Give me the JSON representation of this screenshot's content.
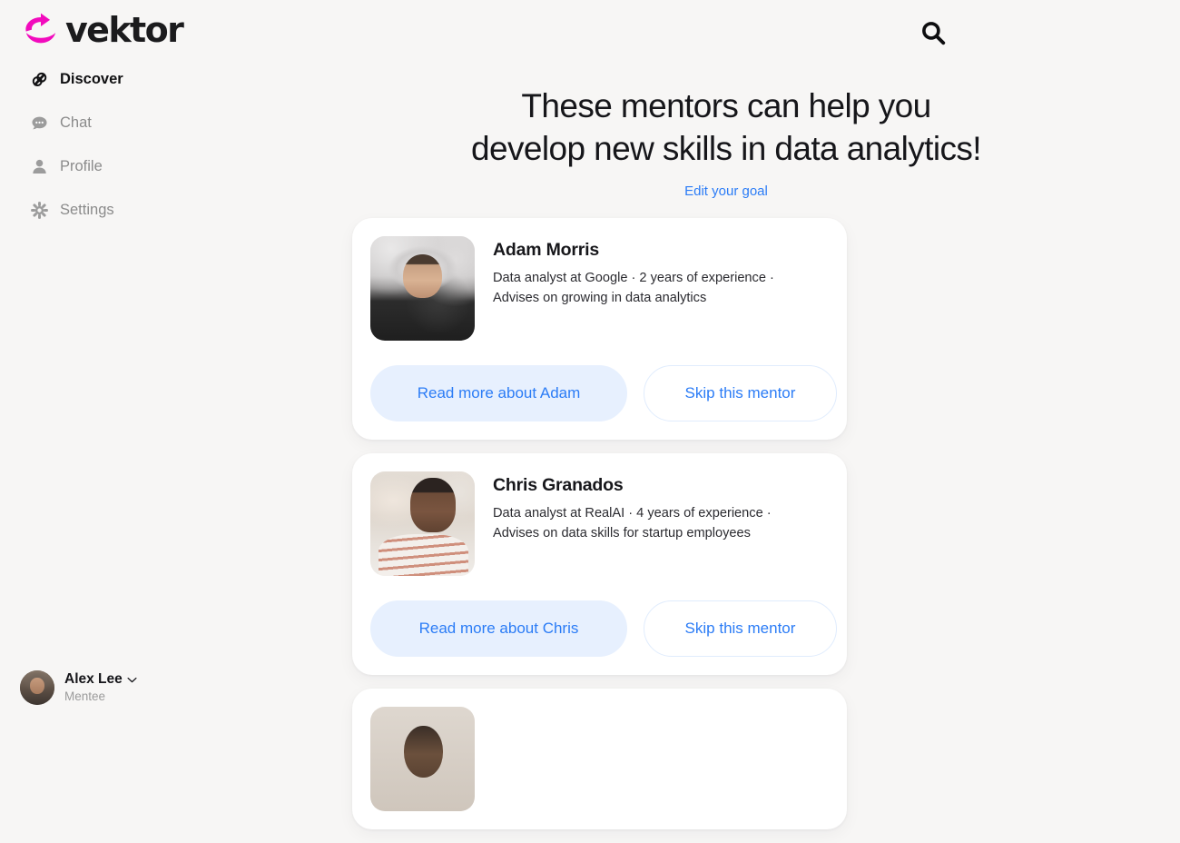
{
  "brand": {
    "name": "vektor",
    "logo_icon": "circular-arrow-icon",
    "logo_color": "#f20bbd"
  },
  "sidebar": {
    "items": [
      {
        "label": "Discover",
        "icon": "discover-icon",
        "active": true
      },
      {
        "label": "Chat",
        "icon": "chat-bubble-icon",
        "active": false
      },
      {
        "label": "Profile",
        "icon": "person-icon",
        "active": false
      },
      {
        "label": "Settings",
        "icon": "gear-icon",
        "active": false
      }
    ],
    "user": {
      "name": "Alex Lee",
      "role": "Mentee",
      "avatar": "user-avatar",
      "chevron_icon": "chevron-down-icon"
    }
  },
  "header": {
    "search_icon": "search-icon"
  },
  "main": {
    "headline_line1": "These mentors can help you",
    "headline_line2": "develop new skills in data analytics!",
    "goal_link": "Edit your goal",
    "link_color": "#2b7cf6",
    "mentors": [
      {
        "name": "Adam Morris",
        "description": "Data analyst at Google  · 2 years of experience · Advises on growing in data analytics",
        "photo": "adam-photo",
        "primary_button": "Read more about Adam",
        "secondary_button": "Skip this mentor"
      },
      {
        "name": "Chris Granados",
        "description": "Data analyst at RealAI · 4 years of experience · Advises on data skills for startup employees",
        "photo": "chris-photo",
        "primary_button": "Read more about Chris",
        "secondary_button": "Skip this mentor"
      }
    ]
  }
}
